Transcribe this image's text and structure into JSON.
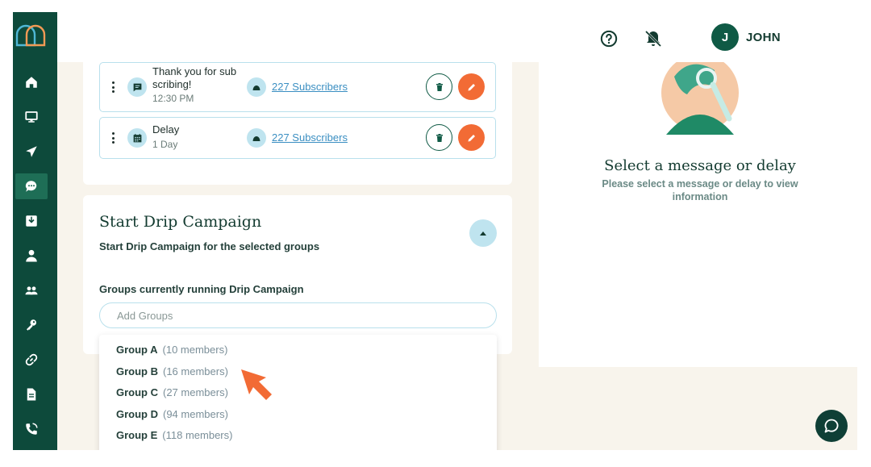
{
  "header": {
    "avatar_initial": "J",
    "username": "JOHN"
  },
  "sidebar": {
    "items": [
      {
        "icon": "home-icon"
      },
      {
        "icon": "monitor-icon"
      },
      {
        "icon": "send-icon"
      },
      {
        "icon": "chat-icon",
        "active": true
      },
      {
        "icon": "inbox-icon"
      },
      {
        "icon": "user-icon"
      },
      {
        "icon": "group-icon"
      },
      {
        "icon": "key-icon"
      },
      {
        "icon": "link-icon"
      },
      {
        "icon": "document-icon"
      },
      {
        "icon": "phone-icon"
      }
    ]
  },
  "messages": [
    {
      "title": "Thank you for sub scribing!",
      "title_line1": "Thank you for sub",
      "title_line2": "scribing!",
      "time": "12:30 PM",
      "subscribers": "227 Subscribers",
      "type_icon": "message-icon"
    },
    {
      "title": "Delay",
      "duration": "1 Day",
      "subscribers": "227 Subscribers",
      "type_icon": "calendar-icon"
    }
  ],
  "drip": {
    "title": "Start Drip Campaign",
    "subtitle": "Start Drip Campaign for the selected groups",
    "groups_label": "Groups currently running Drip Campaign",
    "input_placeholder": "Add Groups"
  },
  "groups": [
    {
      "name": "Group A",
      "members": "(10 members)"
    },
    {
      "name": "Group B",
      "members": "(16 members)"
    },
    {
      "name": "Group C",
      "members": "(27 members)"
    },
    {
      "name": "Group D",
      "members": "(94 members)"
    },
    {
      "name": "Group E",
      "members": "(118 members)"
    }
  ],
  "detail": {
    "empty_title": "Select a message or delay",
    "empty_description": "Please select a message or delay to view information"
  },
  "colors": {
    "sidebar": "#0d4a3b",
    "accent_orange": "#f26b35",
    "primary_green": "#0f5a45",
    "light_blue": "#bfe4ef"
  }
}
